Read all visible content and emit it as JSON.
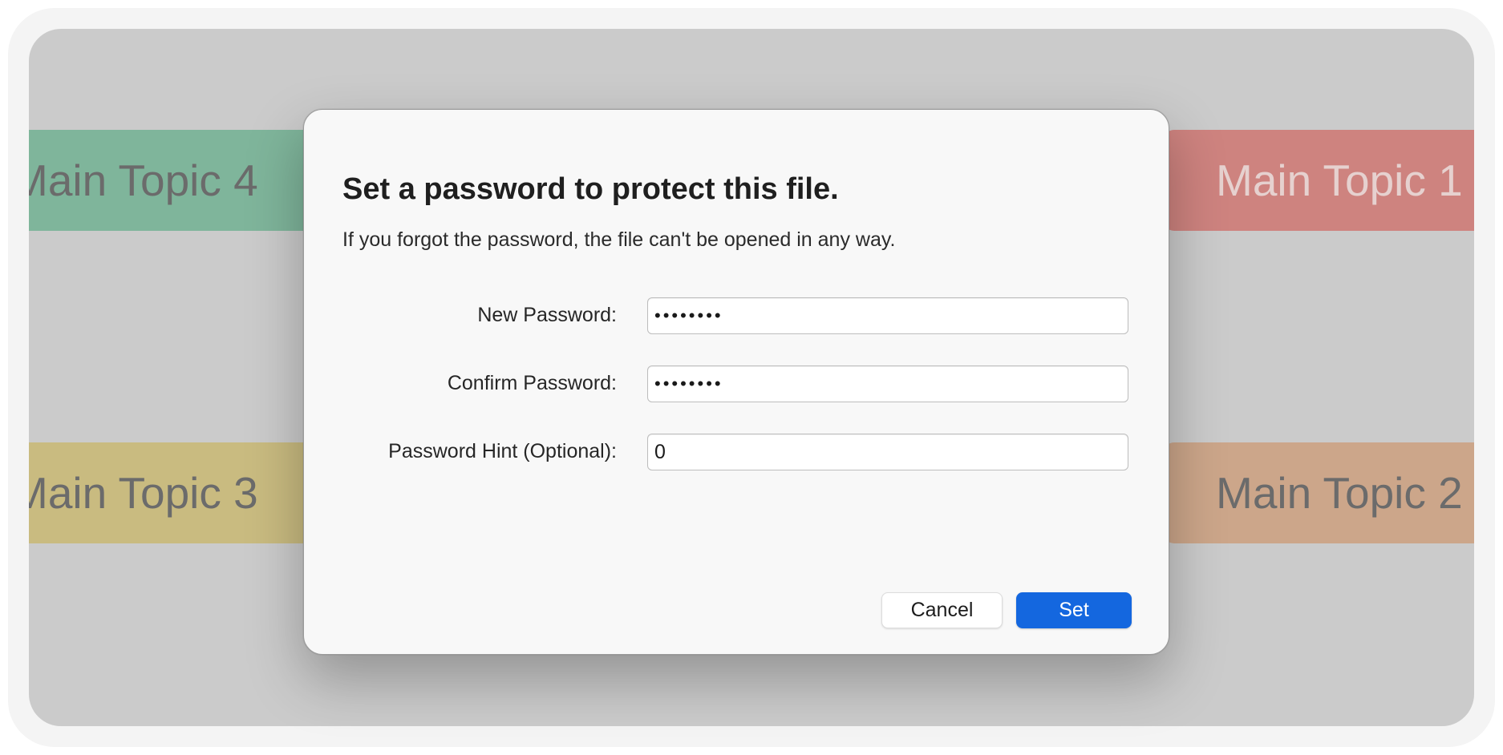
{
  "background": {
    "topics": [
      {
        "id": "topic-4",
        "label": "Main Topic 4",
        "color": "#7fb59b"
      },
      {
        "id": "topic-3",
        "label": "Main Topic 3",
        "color": "#c9bb80"
      },
      {
        "id": "topic-1",
        "label": "Main Topic 1",
        "color": "#ce837f"
      },
      {
        "id": "topic-2",
        "label": "Main Topic 2",
        "color": "#cca68a"
      }
    ]
  },
  "dialog": {
    "title": "Set a password to protect this file.",
    "subtitle": "If you forgot the password, the file can't be opened in any way.",
    "fields": {
      "new_password": {
        "label": "New Password:",
        "value": "••••••••"
      },
      "confirm_password": {
        "label": "Confirm Password:",
        "value": "••••••••"
      },
      "password_hint": {
        "label": "Password Hint (Optional):",
        "value": "0"
      }
    },
    "buttons": {
      "cancel": "Cancel",
      "set": "Set"
    },
    "accent_color": "#1467df"
  }
}
